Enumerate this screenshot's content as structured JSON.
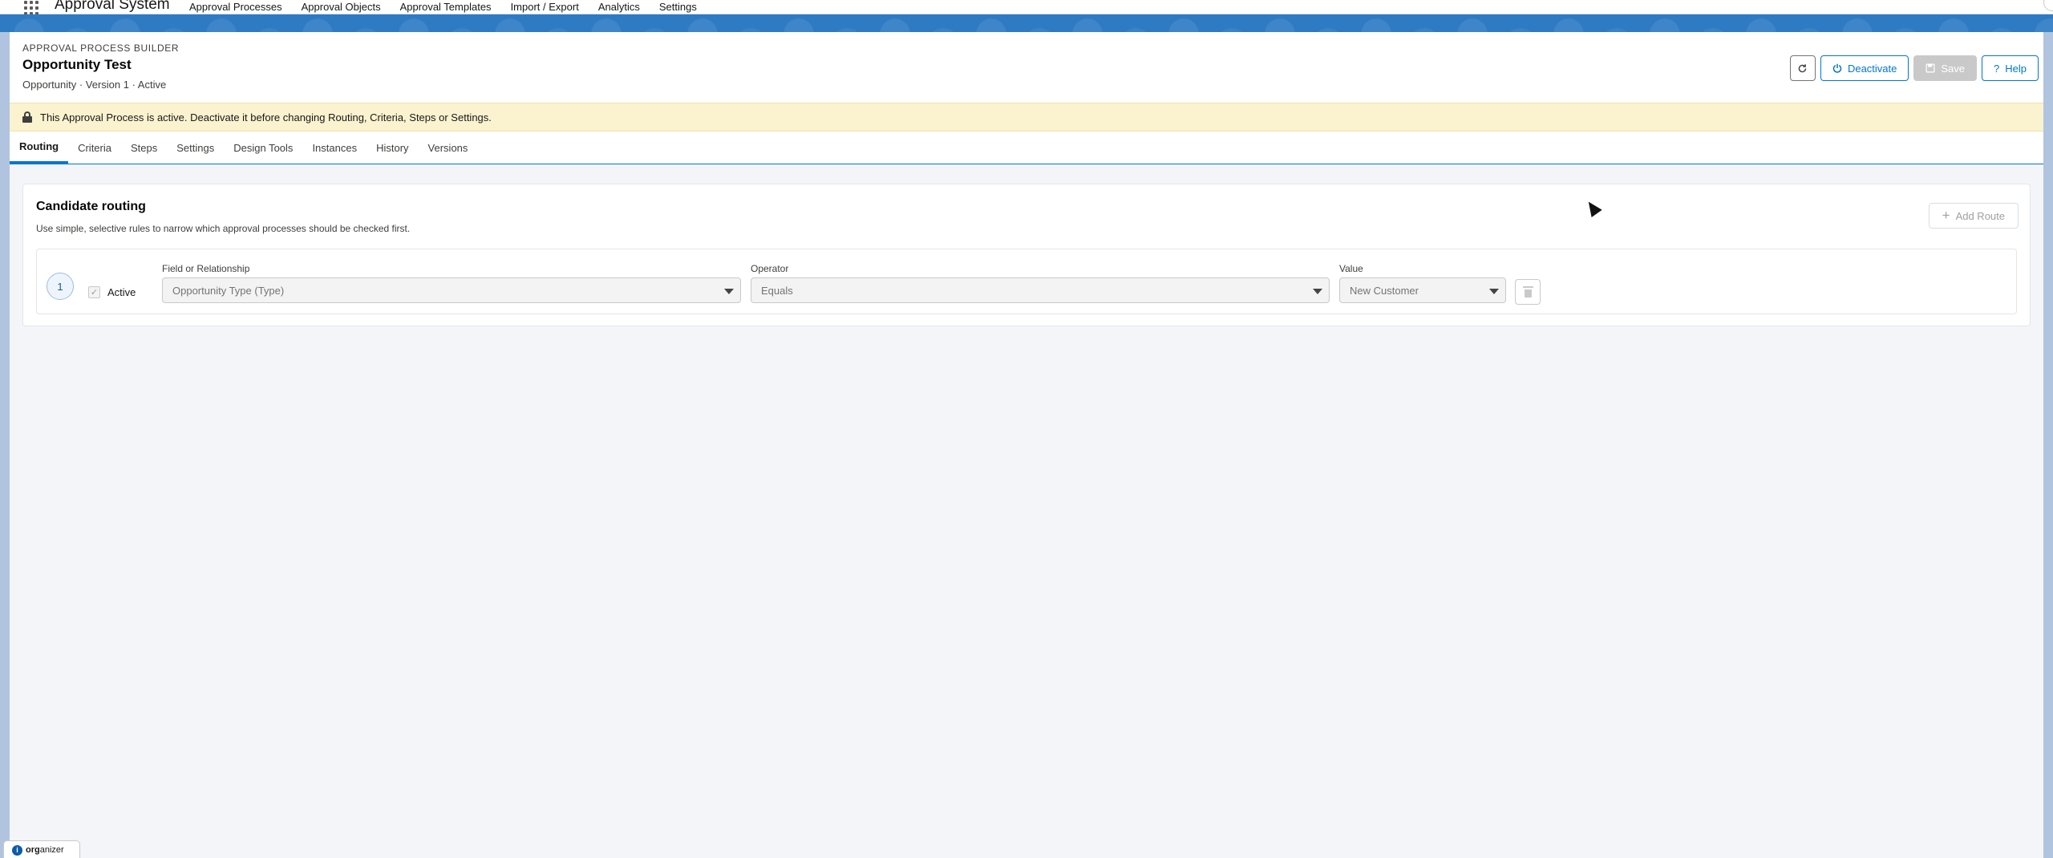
{
  "app": {
    "name": "Approval System"
  },
  "nav": {
    "items": [
      {
        "label": "Approval Processes"
      },
      {
        "label": "Approval Objects"
      },
      {
        "label": "Approval Templates"
      },
      {
        "label": "Import / Export"
      },
      {
        "label": "Analytics"
      },
      {
        "label": "Settings"
      }
    ]
  },
  "header": {
    "eyebrow": "APPROVAL PROCESS BUILDER",
    "title": "Opportunity Test",
    "subtitle": "Opportunity · Version 1 · Active",
    "buttons": {
      "refresh_icon": "refresh-icon",
      "deactivate": "Deactivate",
      "save": "Save",
      "help": "Help"
    }
  },
  "banner": {
    "text": "This Approval Process is active. Deactivate it before changing Routing, Criteria, Steps or Settings.",
    "icon": "lock-icon"
  },
  "tabs": [
    {
      "label": "Routing",
      "active": true
    },
    {
      "label": "Criteria"
    },
    {
      "label": "Steps"
    },
    {
      "label": "Settings"
    },
    {
      "label": "Design Tools"
    },
    {
      "label": "Instances"
    },
    {
      "label": "History"
    },
    {
      "label": "Versions"
    }
  ],
  "routing": {
    "title": "Candidate routing",
    "description": "Use simple, selective rules to narrow which approval processes should be checked first.",
    "add_route": "Add Route",
    "rule": {
      "number": "1",
      "active_label": "Active",
      "active_checked": true,
      "field_label": "Field or Relationship",
      "field_value": "Opportunity Type (Type)",
      "operator_label": "Operator",
      "operator_value": "Equals",
      "value_label": "Value",
      "value_value": "New Customer"
    }
  },
  "footer": {
    "organizer_prefix": "org",
    "organizer_suffix": "anizer"
  },
  "colors": {
    "brand": "#0176d3",
    "band": "#2e7bc4",
    "warning_bg": "#fbf2cf",
    "disabled": "#c9c9c9"
  }
}
